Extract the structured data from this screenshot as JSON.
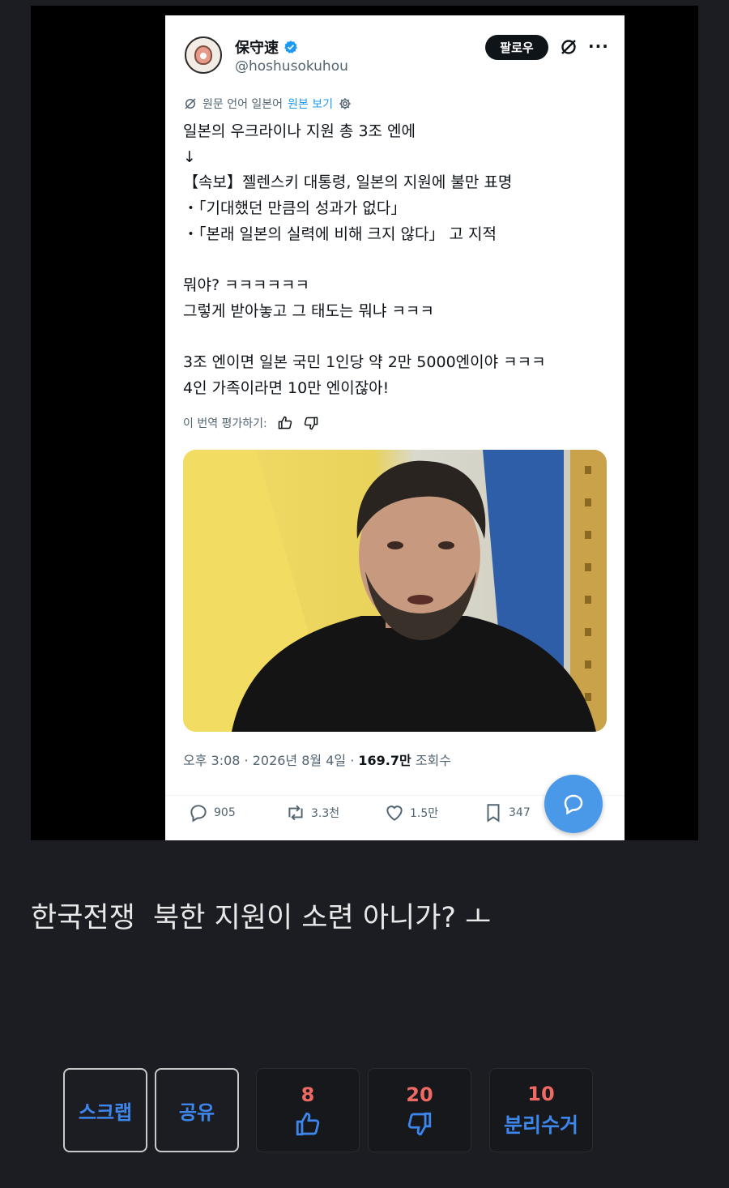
{
  "tweet": {
    "display_name": "保守速",
    "handle": "@hoshusokuhou",
    "follow_label": "팔로우",
    "more_label": "···",
    "translate_info": "원문 언어 일본어",
    "show_original": "원본 보기",
    "body_lines": [
      "일본의 우크라이나 지원 총 3조 엔에",
      "↓",
      "【속보】젤렌스키 대통령, 일본의 지원에 불만 표명",
      "・「기대했던 만큼의 성과가 없다」",
      "・「본래 일본의 실력에 비해 크지 않다」 고 지적",
      "",
      "뭐야? ㅋㅋㅋㅋㅋㅋ",
      "그렇게 받아놓고 그 태도는 뭐냐 ㅋㅋㅋ",
      "",
      "3조 엔이면 일본 국민 1인당 약 2만 5000엔이야 ㅋㅋㅋ",
      "4인 가족이라면 10만 엔이잖아!"
    ],
    "rate_translation": "이 번역 평가하기:",
    "time": "오후 3:08 · 2026년 8월 4일 · ",
    "views_count": "169.7만",
    "views_label": " 조회수",
    "replies": "905",
    "retweets": "3.3천",
    "likes": "1.5만",
    "bookmarks": "347"
  },
  "caption": "한국전쟁  북한 지원이 소련 아니가? ㅗ",
  "buttons": {
    "scrap": "스크랩",
    "share": "공유",
    "upvotes": "8",
    "downvotes": "20",
    "recycle_count": "10",
    "recycle_label": "분리수거"
  },
  "colors": {
    "background": "#1c1d22",
    "accent_blue": "#3d86ec",
    "count_red": "#f06a63",
    "twitter_blue": "#1d9bf0"
  }
}
